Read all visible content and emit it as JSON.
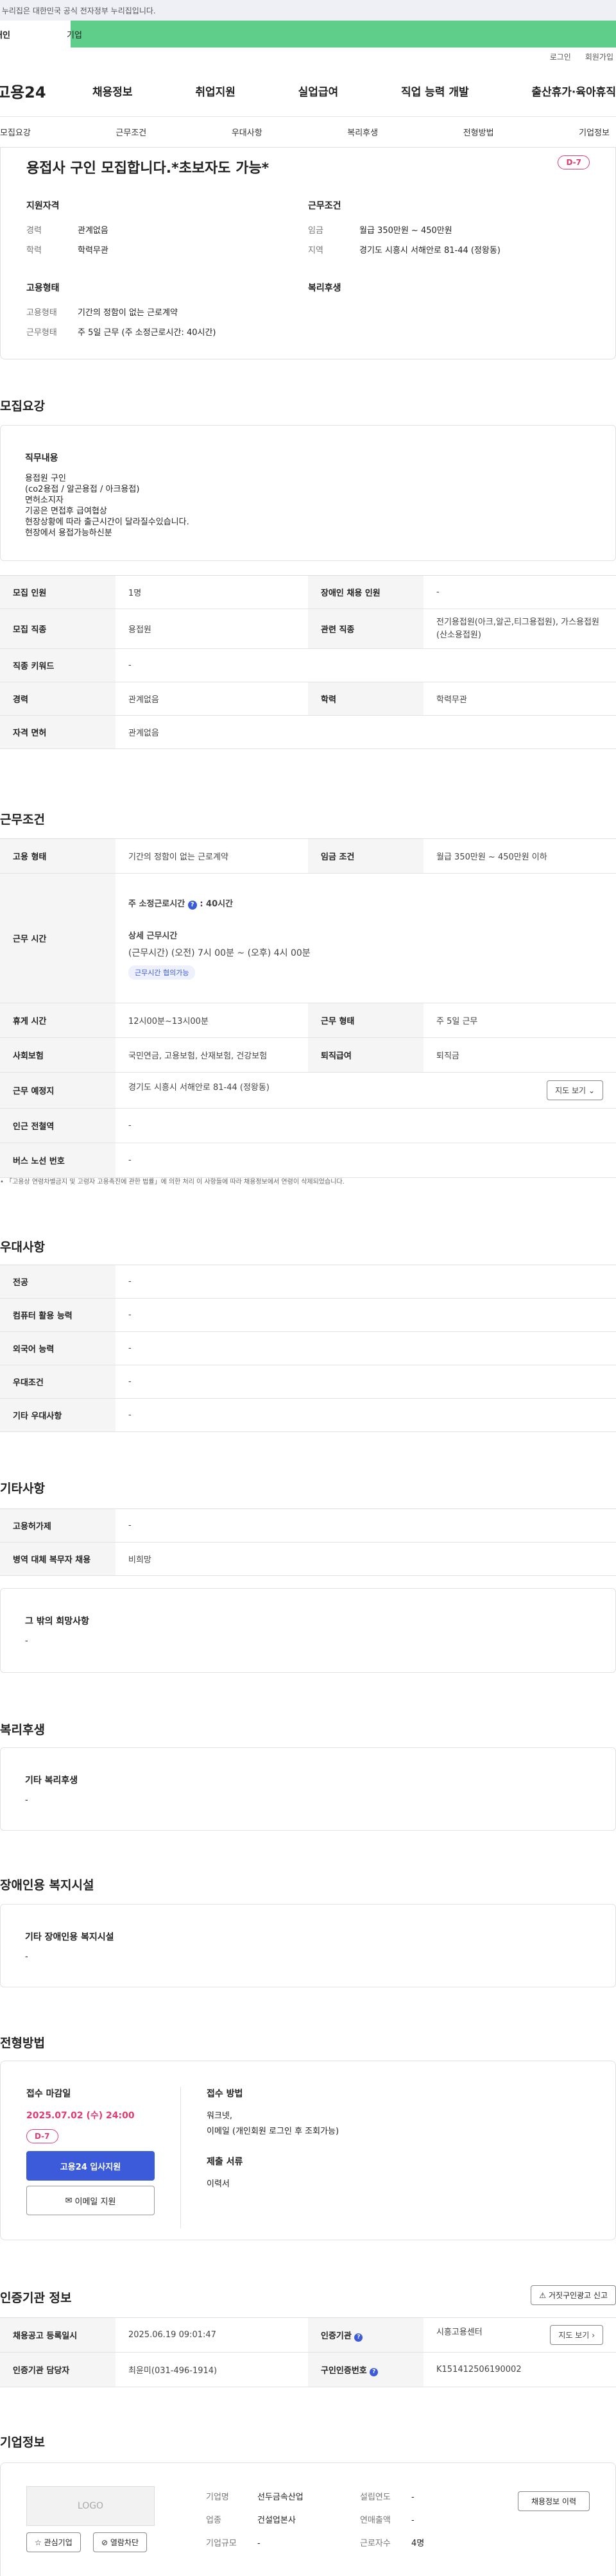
{
  "gov_bar": {
    "text": "이 누리집은 대한민국 공식 전자정부 누리집입니다."
  },
  "gov_tabs": {
    "tab1": "개인",
    "tab2": "기업"
  },
  "top_links": {
    "login": "로그인",
    "join": "회원가입"
  },
  "gnb": {
    "logo": "고용24",
    "menu": [
      "채용정보",
      "취업지원",
      "실업급여",
      "직업 능력 개발",
      "출산휴가·육아휴직"
    ]
  },
  "subtabs": [
    "모집요강",
    "근무조건",
    "우대사항",
    "복리후생",
    "전형방법",
    "기업정보"
  ],
  "job": {
    "title": "용접사 구인 모집합니다.*초보자도 가능*",
    "dday": "D-7",
    "qual_h": "지원자격",
    "career_k": "경력",
    "career_v": "관계없음",
    "edu_k": "학력",
    "edu_v": "학력무관",
    "work_h": "근무조건",
    "wage_k": "임금",
    "wage_v": "월급 350만원 ~ 450만원",
    "region_k": "지역",
    "region_v": "경기도 시흥시 서해안로 81-44 (정왕동)",
    "emp_h": "고용형태",
    "emp_type_k": "고용형태",
    "emp_type_v": "기간의 정함이 없는 근로계약",
    "work_type_k": "근무형태",
    "work_type_v": "주 5일 근무 (주 소정근로시간: 40시간)",
    "welfare_h": "복리후생"
  },
  "recruit": {
    "heading": "모집요강",
    "duty_title": "직무내용",
    "duty_lines": [
      "용접원 구인",
      "(co2용접 / 알곤용접 / 아크용접)",
      "면허소지자",
      "기공은 면접후 급여협상",
      "현장상황에 따라 출근시간이 달라질수있습니다.",
      "현장에서 용접가능하신분"
    ],
    "rows": {
      "count_k": "모집 인원",
      "count_v": "1명",
      "disabled_k": "장애인 채용 인원",
      "disabled_v": "-",
      "job_k": "모집 직종",
      "job_v": "용접원",
      "related_k": "관련 직종",
      "related_v": "전기용접원(아크,알곤,티그용접원), 가스용접원(산소용접원)",
      "keyword_k": "직종 키워드",
      "keyword_v": "-",
      "career_k": "경력",
      "career_v": "관계없음",
      "edu_k": "학력",
      "edu_v": "학력무관",
      "license_k": "자격 면허",
      "license_v": "관계없음"
    }
  },
  "conditions": {
    "heading": "근무조건",
    "emp_k": "고용 형태",
    "emp_v": "기간의 정함이 없는 근로계약",
    "wage_k": "임금 조건",
    "wage_v": "월급 350만원 ~ 450만원 이하",
    "hours_k": "근무 시간",
    "hours_main": "주 소정근로시간",
    "hours_val": ": 40시간",
    "hours_detail_h": "상세 근무시간",
    "hours_detail_v": "(근무시간) (오전) 7시 00분 ~ (오후) 4시 00분",
    "hours_pill": "근무시간 협의가능",
    "rest_k": "휴게 시간",
    "rest_v": "12시00분~13시00분",
    "shift_k": "근무 형태",
    "shift_v": "주 5일 근무",
    "insurance_k": "사회보험",
    "insurance_v": "국민연금, 고용보험, 산재보험, 건강보험",
    "retire_k": "퇴직급여",
    "retire_v": "퇴직금",
    "place_k": "근무 예정지",
    "place_v": "경기도 시흥시 서해안로 81-44 (정왕동)",
    "map_btn": "지도 보기",
    "station_k": "인근 전철역",
    "station_v": "-",
    "bus_k": "버스 노선 번호",
    "bus_v": "-",
    "note": "「고용상 연령차별금지 및 고령자 고용촉진에 관한 법률」에 의한 처리 이 사항들에 따라 채용정보에서 연령이 삭제되었습니다."
  },
  "preference": {
    "heading": "우대사항",
    "rows": [
      {
        "k": "전공",
        "v": "-"
      },
      {
        "k": "컴퓨터 활용 능력",
        "v": "-"
      },
      {
        "k": "외국어 능력",
        "v": "-"
      },
      {
        "k": "우대조건",
        "v": "-"
      },
      {
        "k": "기타 우대사항",
        "v": "-"
      }
    ]
  },
  "etc": {
    "heading": "기타사항",
    "rows": [
      {
        "k": "고용허가제",
        "v": "-"
      },
      {
        "k": "병역 대체 복무자 채용",
        "v": "비희망"
      }
    ],
    "wish_title": "그 밖의 희망사항",
    "wish_v": "-"
  },
  "welfare": {
    "heading": "복리후생",
    "title": "기타 복리후생",
    "v": "-"
  },
  "disabled_facility": {
    "heading": "장애인용 복지시설",
    "title": "기타 장애인용 복지시설",
    "v": "-"
  },
  "selection": {
    "heading": "전형방법",
    "deadline_h": "접수 마감일",
    "deadline_v": "2025.07.02 (수) 24:00",
    "dday": "D-7",
    "apply_btn": "고용24 입사지원",
    "email_btn": "이메일 지원",
    "method_h": "접수 방법",
    "method_v1": "워크넷,",
    "method_v2": "이메일 (개인회원 로그인 후 조회가능)",
    "docs_h": "제출 서류",
    "docs_v": "이력서"
  },
  "cert": {
    "heading": "인증기관 정보",
    "report_btn": "거짓구인광고 신고",
    "reg_k": "채용공고 등록일시",
    "reg_v": "2025.06.19 09:01:47",
    "org_k": "인증기관",
    "org_v": "시흥고용센터",
    "map_btn": "지도 보기",
    "manager_k": "인증기관 담당자",
    "manager_v": "최윤미(031-496-1914)",
    "num_k": "구인인증번호",
    "num_v": "K151412506190002"
  },
  "company": {
    "heading": "기업정보",
    "logo_text": "LOGO",
    "fav_btn": "관심기업",
    "block_btn": "열람차단",
    "name_k": "기업명",
    "name_v": "선두금속산업",
    "industry_k": "업종",
    "industry_v": "건설업본사",
    "size_k": "기업규모",
    "size_v": "-",
    "year_k": "설립연도",
    "year_v": "-",
    "sales_k": "연매출액",
    "sales_v": "-",
    "emp_k": "근로자수",
    "emp_v": "4명",
    "history_btn": "채용정보 이력"
  }
}
